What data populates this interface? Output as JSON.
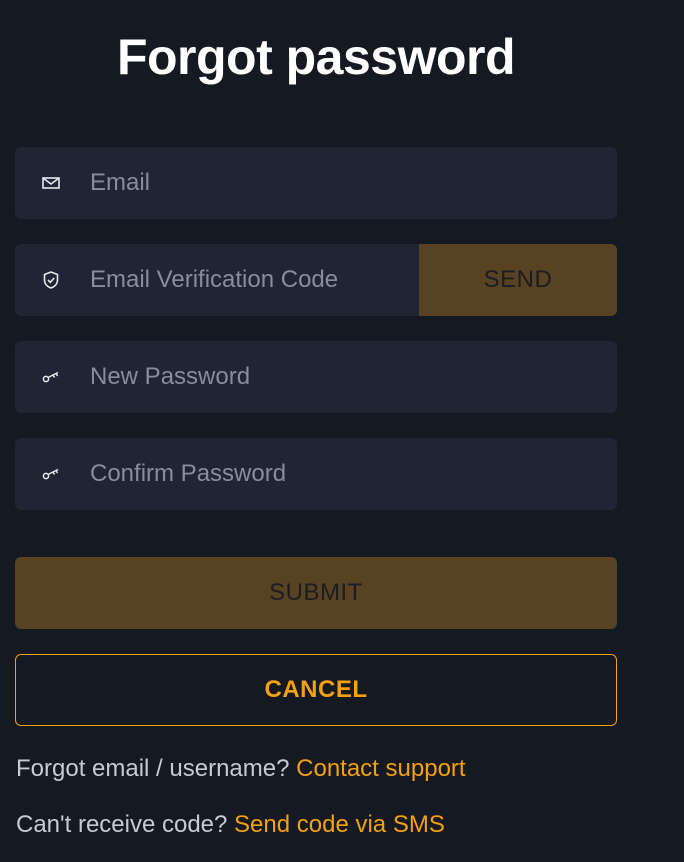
{
  "title": "Forgot password",
  "fields": {
    "email": {
      "placeholder": "Email",
      "value": "",
      "icon": "mail-icon"
    },
    "verification_code": {
      "placeholder": "Email Verification Code",
      "value": "",
      "icon": "shield-check-icon",
      "send_label": "SEND"
    },
    "new_password": {
      "placeholder": "New Password",
      "value": "",
      "icon": "key-icon"
    },
    "confirm_password": {
      "placeholder": "Confirm Password",
      "value": "",
      "icon": "key-icon"
    }
  },
  "buttons": {
    "submit_label": "SUBMIT",
    "cancel_label": "CANCEL"
  },
  "help": {
    "forgot_email_text": "Forgot email / username?",
    "contact_support_link": "Contact support",
    "cant_receive_text": "Can't receive code?",
    "sms_link": "Send code via SMS"
  },
  "colors": {
    "background": "#151922",
    "field_bg": "#1f2535",
    "accent": "#f5a00f",
    "disabled_button_bg": "#574222"
  }
}
